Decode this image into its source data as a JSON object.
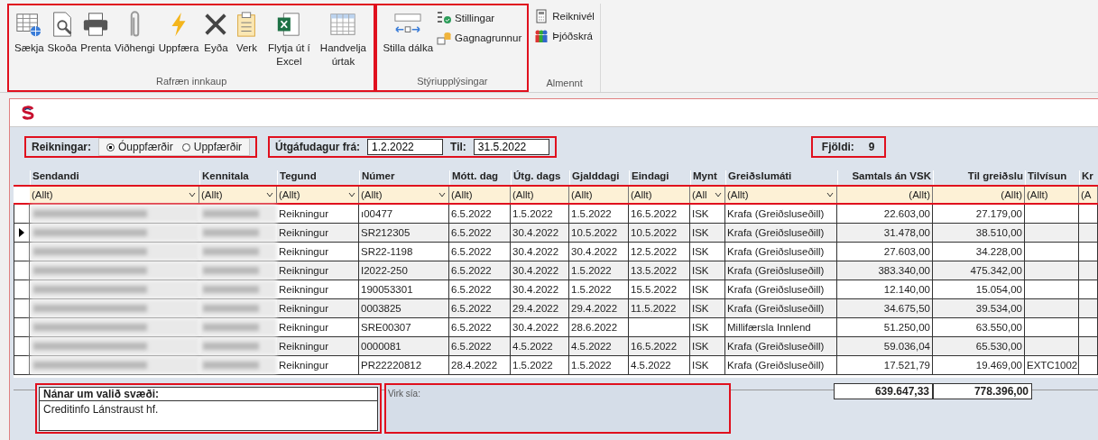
{
  "ribbon": {
    "groups": [
      {
        "label": "Rafræn innkaup",
        "buttons": [
          {
            "label": "Sækja"
          },
          {
            "label": "Skoða"
          },
          {
            "label": "Prenta"
          },
          {
            "label": "Viðhengi"
          },
          {
            "label": "Uppfæra"
          },
          {
            "label": "Eyða"
          },
          {
            "label": "Verk"
          },
          {
            "label": "Flytja út í Excel"
          },
          {
            "label": "Handvelja úrtak"
          }
        ]
      },
      {
        "label": "Stýriupplýsingar",
        "buttons": [
          {
            "label": "Stilla dálka"
          }
        ],
        "small": [
          {
            "label": "Stillingar"
          },
          {
            "label": "Gagnagrunnur"
          }
        ]
      },
      {
        "label": "Almennt",
        "small": [
          {
            "label": "Reiknivél"
          },
          {
            "label": "Þjóðskrá"
          }
        ]
      }
    ]
  },
  "filters": {
    "label": "Reikningar:",
    "options": [
      {
        "label": "Óuppfærðir",
        "selected": true
      },
      {
        "label": "Uppfærðir",
        "selected": false
      }
    ],
    "date_from_label": "Útgáfudagur frá:",
    "date_from": "1.2.2022",
    "date_to_label": "Til:",
    "date_to": "31.5.2022",
    "count_label": "Fjöldi:",
    "count": "9"
  },
  "table": {
    "columns": [
      {
        "label": "Sendandi",
        "filter": "(Allt)",
        "dropdown": true
      },
      {
        "label": "Kennitala",
        "filter": "(Allt)",
        "dropdown": true
      },
      {
        "label": "Tegund",
        "filter": "(Allt)",
        "dropdown": true
      },
      {
        "label": "Númer",
        "filter": "(Allt)",
        "dropdown": true
      },
      {
        "label": "Mótt. dag",
        "filter": "(Allt)",
        "dropdown": false
      },
      {
        "label": "Útg. dags",
        "filter": "(Allt)",
        "dropdown": false
      },
      {
        "label": "Gjalddagi",
        "filter": "(Allt)",
        "dropdown": false
      },
      {
        "label": "Eindagi",
        "filter": "(Allt)",
        "dropdown": false
      },
      {
        "label": "Mynt",
        "filter": "(All",
        "dropdown": true
      },
      {
        "label": "Greiðslumáti",
        "filter": "(Allt)",
        "dropdown": true
      },
      {
        "label": "Samtals án VSK",
        "filter": "(Allt)",
        "dropdown": false
      },
      {
        "label": "Til greiðslu",
        "filter": "(Allt)",
        "dropdown": false
      },
      {
        "label": "Tilvísun",
        "filter": "(Allt)",
        "dropdown": false
      },
      {
        "label": "Kr",
        "filter": "(A",
        "dropdown": false
      }
    ],
    "rows": [
      {
        "selected": false,
        "cells": [
          "",
          "",
          "Reikningur",
          "ı00477",
          "6.5.2022",
          "1.5.2022",
          "1.5.2022",
          "16.5.2022",
          "ISK",
          "Krafa (Greiðsluseðill)",
          "22.603,00",
          "27.179,00",
          "",
          ""
        ]
      },
      {
        "selected": true,
        "cells": [
          "",
          "",
          "Reikningur",
          "SR212305",
          "6.5.2022",
          "30.4.2022",
          "10.5.2022",
          "10.5.2022",
          "ISK",
          "Krafa (Greiðsluseðill)",
          "31.478,00",
          "38.510,00",
          "",
          ""
        ]
      },
      {
        "selected": false,
        "cells": [
          "",
          "",
          "Reikningur",
          "SR22-1198",
          "6.5.2022",
          "30.4.2022",
          "30.4.2022",
          "12.5.2022",
          "ISK",
          "Krafa (Greiðsluseðill)",
          "27.603,00",
          "34.228,00",
          "",
          ""
        ]
      },
      {
        "selected": false,
        "cells": [
          "",
          "",
          "Reikningur",
          "I2022-250",
          "6.5.2022",
          "30.4.2022",
          "1.5.2022",
          "13.5.2022",
          "ISK",
          "Krafa (Greiðsluseðill)",
          "383.340,00",
          "475.342,00",
          "",
          ""
        ]
      },
      {
        "selected": false,
        "cells": [
          "",
          "",
          "Reikningur",
          "190053301",
          "6.5.2022",
          "30.4.2022",
          "1.5.2022",
          "15.5.2022",
          "ISK",
          "Krafa (Greiðsluseðill)",
          "12.140,00",
          "15.054,00",
          "",
          ""
        ]
      },
      {
        "selected": false,
        "cells": [
          "",
          "",
          "Reikningur",
          "0003825",
          "6.5.2022",
          "29.4.2022",
          "29.4.2022",
          "11.5.2022",
          "ISK",
          "Krafa (Greiðsluseðill)",
          "34.675,50",
          "39.534,00",
          "",
          ""
        ]
      },
      {
        "selected": false,
        "cells": [
          "",
          "",
          "Reikningur",
          "SRE00307",
          "6.5.2022",
          "30.4.2022",
          "28.6.2022",
          "",
          "ISK",
          "Millifærsla Innlend",
          "51.250,00",
          "63.550,00",
          "",
          ""
        ]
      },
      {
        "selected": false,
        "cells": [
          "",
          "",
          "Reikningur",
          "0000081",
          "6.5.2022",
          "4.5.2022",
          "4.5.2022",
          "16.5.2022",
          "ISK",
          "Krafa (Greiðsluseðill)",
          "59.036,04",
          "65.530,00",
          "",
          ""
        ]
      },
      {
        "selected": false,
        "cells": [
          "",
          "",
          "Reikningur",
          "PR22220812",
          "28.4.2022",
          "1.5.2022",
          "1.5.2022",
          "4.5.2022",
          "ISK",
          "Krafa (Greiðsluseðill)",
          "17.521,79",
          "19.469,00",
          "EXTC1002",
          ""
        ]
      }
    ],
    "totals": [
      "639.647,33",
      "778.396,00"
    ]
  },
  "details": {
    "label": "Nánar um valið svæði:",
    "value": "Creditinfo Lánstraust hf.",
    "filter_label": "Virk sía:"
  }
}
